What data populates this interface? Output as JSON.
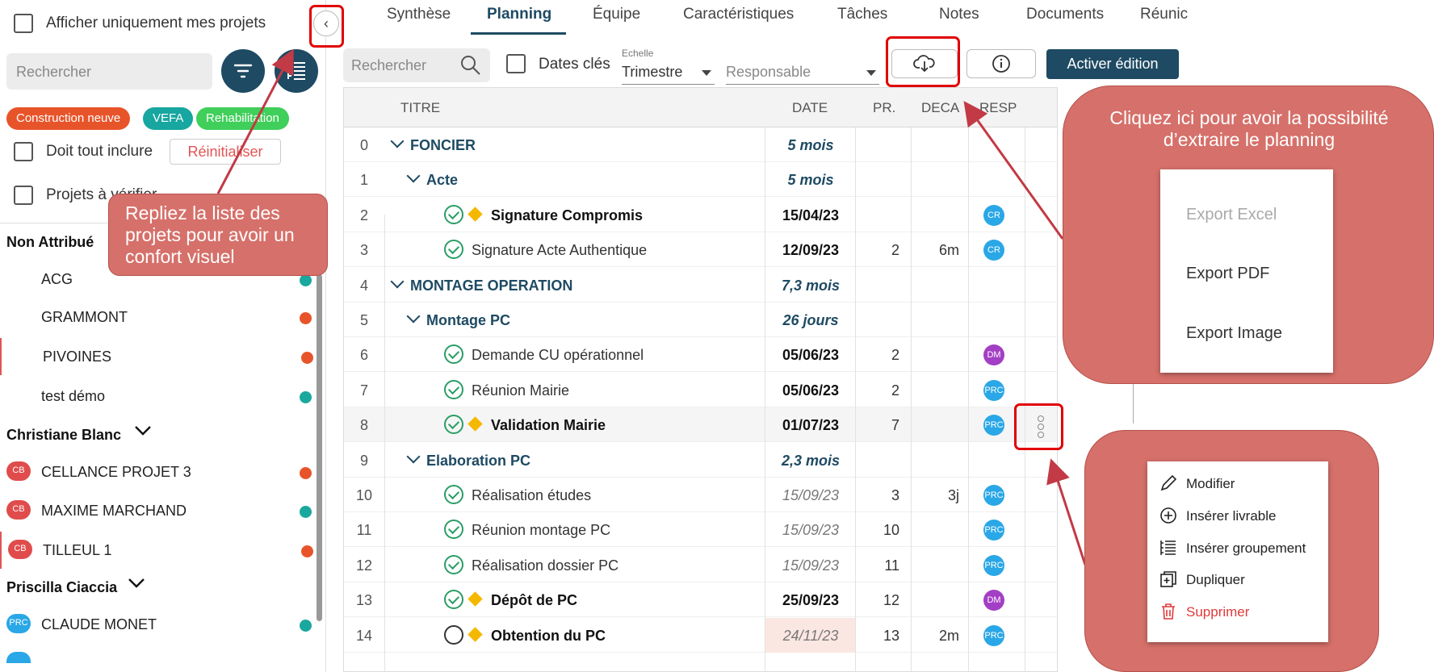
{
  "sidebar": {
    "only_my_projects": "Afficher uniquement mes projets",
    "search_placeholder": "Rechercher",
    "chips": [
      {
        "label": "Construction neuve",
        "color": "#e8542a"
      },
      {
        "label": "VEFA",
        "color": "#17a6a0"
      },
      {
        "label": "Rehabilitation",
        "color": "#3fcf5a"
      }
    ],
    "must_include_all": "Doit tout inclure",
    "reset": "Réinitialiser",
    "to_verify": "Projets à vérifier",
    "groups": [
      {
        "title": "Non Attribué",
        "items": [
          {
            "name": "ACG",
            "status": "#1aa89e"
          },
          {
            "name": "GRAMMONT",
            "status": "#e8542a"
          },
          {
            "name": "PIVOINES",
            "status": "#e8542a"
          },
          {
            "name": "test démo",
            "status": "#1aa89e"
          }
        ]
      },
      {
        "title": "Christiane Blanc",
        "items": [
          {
            "badge": "CB",
            "name": "CELLANCE PROJET 3",
            "status": "#e8542a"
          },
          {
            "badge": "CB",
            "name": "MAXIME MARCHAND",
            "status": "#1aa89e"
          },
          {
            "badge": "CB",
            "name": "TILLEUL 1",
            "status": "#e8542a"
          }
        ]
      },
      {
        "title": "Priscilla Ciaccia",
        "items": [
          {
            "badge": "PRC",
            "name": "CLAUDE MONET",
            "status": "#1aa89e"
          }
        ]
      }
    ]
  },
  "tabs": [
    "Synthèse",
    "Planning",
    "Équipe",
    "Caractéristiques",
    "Tâches",
    "Notes",
    "Documents",
    "Réunic"
  ],
  "active_tab": "Planning",
  "toolbar": {
    "search_placeholder": "Rechercher",
    "key_dates": "Dates clés",
    "scale_label": "Echelle",
    "scale_value": "Trimestre",
    "owner_placeholder": "Responsable",
    "activate_edit": "Activer édition"
  },
  "grid": {
    "headers": {
      "title": "TITRE",
      "date": "DATE",
      "pr": "PR.",
      "deca": "DECA",
      "resp": "RESP"
    },
    "rows": [
      {
        "idx": "0",
        "title": "FONCIER",
        "kind": "group",
        "level": 0,
        "date": "5 mois"
      },
      {
        "idx": "1",
        "title": "Acte",
        "kind": "group",
        "level": 1,
        "date": "5 mois"
      },
      {
        "idx": "2",
        "title": "Signature Compromis",
        "kind": "milestone",
        "level": 2,
        "date": "15/04/23",
        "date_style": "bold",
        "resp": "CR"
      },
      {
        "idx": "3",
        "title": "Signature Acte Authentique",
        "kind": "task",
        "level": 2,
        "date": "12/09/23",
        "date_style": "bold",
        "pr": "2",
        "deca": "6m",
        "resp": "CR"
      },
      {
        "idx": "4",
        "title": "MONTAGE OPERATION",
        "kind": "group",
        "level": 0,
        "date": "7,3 mois"
      },
      {
        "idx": "5",
        "title": "Montage PC",
        "kind": "group",
        "level": 1,
        "date": "26 jours"
      },
      {
        "idx": "6",
        "title": "Demande CU opérationnel",
        "kind": "task",
        "level": 2,
        "date": "05/06/23",
        "date_style": "bold",
        "pr": "2",
        "resp": "DM"
      },
      {
        "idx": "7",
        "title": "Réunion Mairie",
        "kind": "task",
        "level": 2,
        "date": "05/06/23",
        "date_style": "bold",
        "pr": "2",
        "resp": "PRC"
      },
      {
        "idx": "8",
        "title": "Validation Mairie",
        "kind": "milestone",
        "level": 2,
        "date": "01/07/23",
        "date_style": "bold",
        "pr": "7",
        "resp": "PRC",
        "highlight": true
      },
      {
        "idx": "9",
        "title": "Elaboration PC",
        "kind": "group",
        "level": 1,
        "date": "2,3 mois"
      },
      {
        "idx": "10",
        "title": "Réalisation études",
        "kind": "task",
        "level": 2,
        "date": "15/09/23",
        "date_style": "italic",
        "pr": "3",
        "deca": "3j",
        "resp": "PRC"
      },
      {
        "idx": "11",
        "title": "Réunion montage PC",
        "kind": "task",
        "level": 2,
        "date": "15/09/23",
        "date_style": "italic",
        "pr": "10",
        "resp": "PRC"
      },
      {
        "idx": "12",
        "title": "Réalisation dossier PC",
        "kind": "task",
        "level": 2,
        "date": "15/09/23",
        "date_style": "italic",
        "pr": "11",
        "resp": "PRC"
      },
      {
        "idx": "13",
        "title": "Dépôt de PC",
        "kind": "milestone",
        "level": 2,
        "date": "25/09/23",
        "date_style": "bold",
        "pr": "12",
        "resp": "DM"
      },
      {
        "idx": "14",
        "title": "Obtention du PC",
        "kind": "milestone-open",
        "level": 2,
        "date": "24/11/23",
        "date_style": "italic-late",
        "pr": "13",
        "deca": "2m",
        "resp": "PRC"
      }
    ]
  },
  "resp_colors": {
    "CR": "#2aa7e6",
    "DM": "#a33fc4",
    "PRC": "#2aa7e6",
    "CB": "#e04c4c"
  },
  "annotations": {
    "collapse_note": "Repliez la liste des projets pour avoir un confort visuel",
    "export_note": "Cliquez ici pour avoir la possibilité d’extraire le planning",
    "export_menu": [
      "Export Excel",
      "Export PDF",
      "Export Image"
    ],
    "context_menu": [
      "Modifier",
      "Insérer livrable",
      "Insérer groupement",
      "Dupliquer",
      "Supprimer"
    ]
  }
}
